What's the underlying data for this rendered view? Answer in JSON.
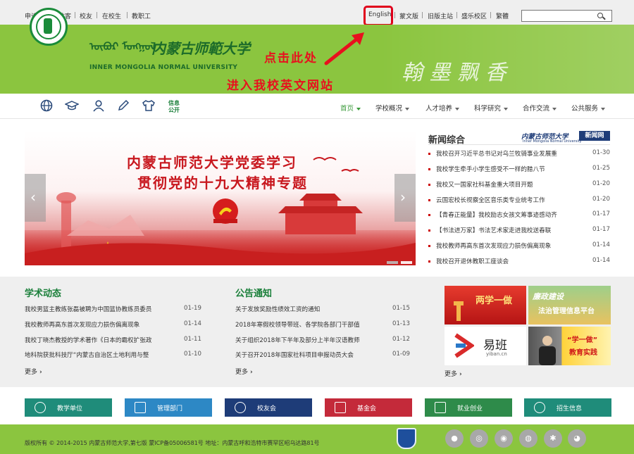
{
  "topbar": {
    "left_links": [
      "申请入读",
      "访客",
      "校友",
      "在校生",
      "教职工"
    ],
    "right_links": [
      "English",
      "蒙文版",
      "旧版主站",
      "盛乐校区",
      "繁體"
    ],
    "search": {
      "placeholder": ""
    }
  },
  "header": {
    "name_cn": "内蒙古师範大学",
    "name_en": "INNER MONGOLIA NORMAL UNIVERSITY",
    "hint_line1": "点击此处",
    "hint_line2": "进入我校英文网站",
    "accent_red": "#e0001b",
    "brand_green": "#8bc53f"
  },
  "nav": {
    "icons": [
      "globe-icon",
      "graduation-cap-icon",
      "person-icon",
      "pencil-icon",
      "shirt-icon"
    ],
    "info_public": "信息\n公开",
    "items": [
      "首页",
      "学校概况",
      "人才培养",
      "科学研究",
      "合作交流",
      "公共服务"
    ],
    "active": "首页"
  },
  "slider": {
    "title_line1": "内蒙古师范大学党委学习",
    "title_line2": "贯彻党的十九大精神专题"
  },
  "news": {
    "title": "新闻综合",
    "badge_cn": "内蒙古师范大学",
    "badge_box": "新闻网",
    "badge_en": "Inner Mongolia Normal University",
    "items": [
      {
        "title": "我校召开习近平总书记对乌兰牧骑事业发展重",
        "date": "01-30"
      },
      {
        "title": "我校学生牵手小学生感受不一样的腊八节",
        "date": "01-25"
      },
      {
        "title": "我校又一国家社科基金重大项目开题",
        "date": "01-20"
      },
      {
        "title": "云国宏校长视察全区音乐类专业统考工作",
        "date": "01-20"
      },
      {
        "title": "【青春正能量】我校励志女孩文筹事迹感动齐",
        "date": "01-17"
      },
      {
        "title": "【书法进万家】书法艺术家走进我校送春联",
        "date": "01-17"
      },
      {
        "title": "我校教师再高东首次发现应力损伤偏离现象",
        "date": "01-14"
      },
      {
        "title": "我校召开退休教职工座谈会",
        "date": "01-14"
      }
    ]
  },
  "academic": {
    "title": "学术动态",
    "items": [
      {
        "title": "我校男篮主教练张磊被聘为中国篮协教练员委员",
        "date": "01-19"
      },
      {
        "title": "我校教师再高东首次发现应力损伤偏离现象",
        "date": "01-14"
      },
      {
        "title": "我校丁晓杰教授的学术著作《日本的霸权扩张政",
        "date": "01-11"
      },
      {
        "title": "地科院获批科技厅“内蒙古自治区土地利用与整",
        "date": "01-10"
      }
    ],
    "more": "更多"
  },
  "notice": {
    "title": "公告通知",
    "items": [
      {
        "title": "关于发放奖励性绩效工资的通知",
        "date": "01-15"
      },
      {
        "title": "2018年寒假校领导带班、各学院各部门干部值",
        "date": "01-13"
      },
      {
        "title": "关于组织2018年下半年及部分上半年汉语教师",
        "date": "01-12"
      },
      {
        "title": "关于召开2018年国家社科项目申报动员大会",
        "date": "01-09"
      }
    ],
    "more": "更多"
  },
  "ads": {
    "ad1": "两学一做",
    "ad2_line1": "廉政建设",
    "ad2_line2": "法治管理信息平台",
    "ad3": "易班",
    "ad3_sub": "yiban.cn",
    "ad4_line1": "“学一做”",
    "ad4_line2": "教育实践",
    "more": "更多"
  },
  "buttons": [
    {
      "label": "教学单位",
      "color": "#1f8c7a",
      "icon": "globe-icon"
    },
    {
      "label": "管理部门",
      "color": "#2d88c5",
      "icon": "monitor-icon"
    },
    {
      "label": "校友会",
      "color": "#1e3c78",
      "icon": "group-icon"
    },
    {
      "label": "基金会",
      "color": "#c42a3a",
      "icon": "briefcase-icon"
    },
    {
      "label": "就业创业",
      "color": "#2e8b4a",
      "icon": "list-icon"
    },
    {
      "label": "招生信息",
      "color": "#1f8c7a",
      "icon": "clock-icon"
    }
  ],
  "footer": {
    "copyright": "版权所有 © 2014-2015 内蒙古师范大学,第七版 蒙ICP备05006581号 地址：内蒙古呼和浩特市赛罕区昭乌达路81号",
    "social_icons": [
      "apple-icon",
      "rss-icon",
      "weibo-icon",
      "renren-icon",
      "settings-icon",
      "wechat-icon"
    ]
  }
}
